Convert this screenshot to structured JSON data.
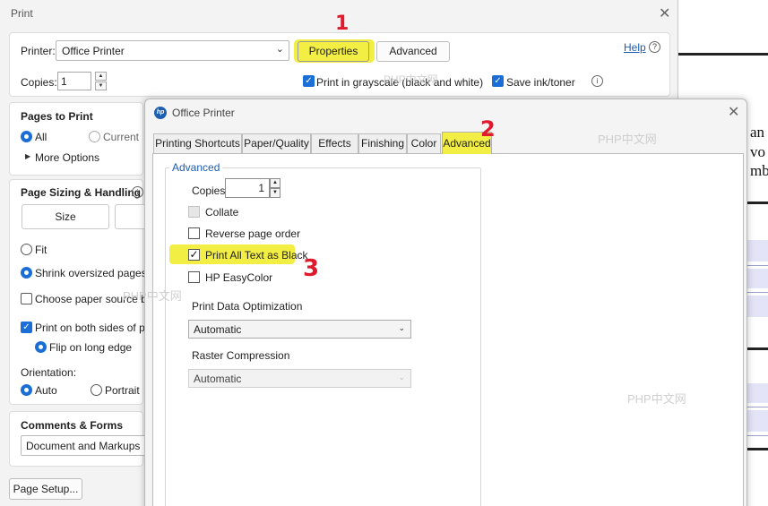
{
  "background_doc": {
    "fragments": [
      "an",
      "vo",
      "mb"
    ]
  },
  "print_dialog": {
    "title": "Print",
    "printer_label": "Printer:",
    "printer_value": "Office Printer",
    "properties_label": "Properties",
    "advanced_label": "Advanced",
    "help_label": "Help",
    "copies_label": "Copies:",
    "copies_value": "1",
    "grayscale_label": "Print in grayscale (black and white)",
    "grayscale_checked": true,
    "save_ink_label": "Save ink/toner",
    "save_ink_checked": true,
    "pages_to_print": {
      "heading": "Pages to Print",
      "all_label": "All",
      "current_label": "Current",
      "more_options_label": "More Options"
    },
    "page_sizing": {
      "heading": "Page Sizing & Handling",
      "size_label": "Size",
      "fit_label": "Fit",
      "shrink_label": "Shrink oversized pages",
      "paper_source_label": "Choose paper source by",
      "both_sides_label": "Print on both sides of pap",
      "flip_label": "Flip on long edge",
      "orientation_label": "Orientation:",
      "auto_label": "Auto",
      "portrait_label": "Portrait"
    },
    "comments": {
      "heading": "Comments & Forms",
      "value": "Document and Markups"
    },
    "page_setup_label": "Page Setup..."
  },
  "properties_dialog": {
    "title": "Office Printer",
    "tabs": [
      {
        "label": "Printing Shortcuts"
      },
      {
        "label": "Paper/Quality"
      },
      {
        "label": "Effects"
      },
      {
        "label": "Finishing"
      },
      {
        "label": "Color"
      },
      {
        "label": "Advanced"
      }
    ],
    "active_tab": "Advanced",
    "group_title": "Advanced",
    "copies_label": "Copies",
    "copies_value": "1",
    "collate_label": "Collate",
    "reverse_label": "Reverse page order",
    "print_black_label": "Print All Text as Black",
    "print_black_checked": true,
    "easycolor_label": "HP EasyColor",
    "data_opt_label": "Print Data Optimization",
    "data_opt_value": "Automatic",
    "raster_label": "Raster Compression",
    "raster_value": "Automatic"
  },
  "annotations": [
    "1",
    "2",
    "3"
  ],
  "watermarks": [
    "PHP中文网",
    "PHP中文网",
    "PHP中文网",
    "PHP中文网"
  ],
  "colors": {
    "accent_blue": "#1a6ed6",
    "highlight_yellow": "#f2ee44",
    "annotation_red": "#e0192c",
    "link_blue": "#1a5db4"
  }
}
